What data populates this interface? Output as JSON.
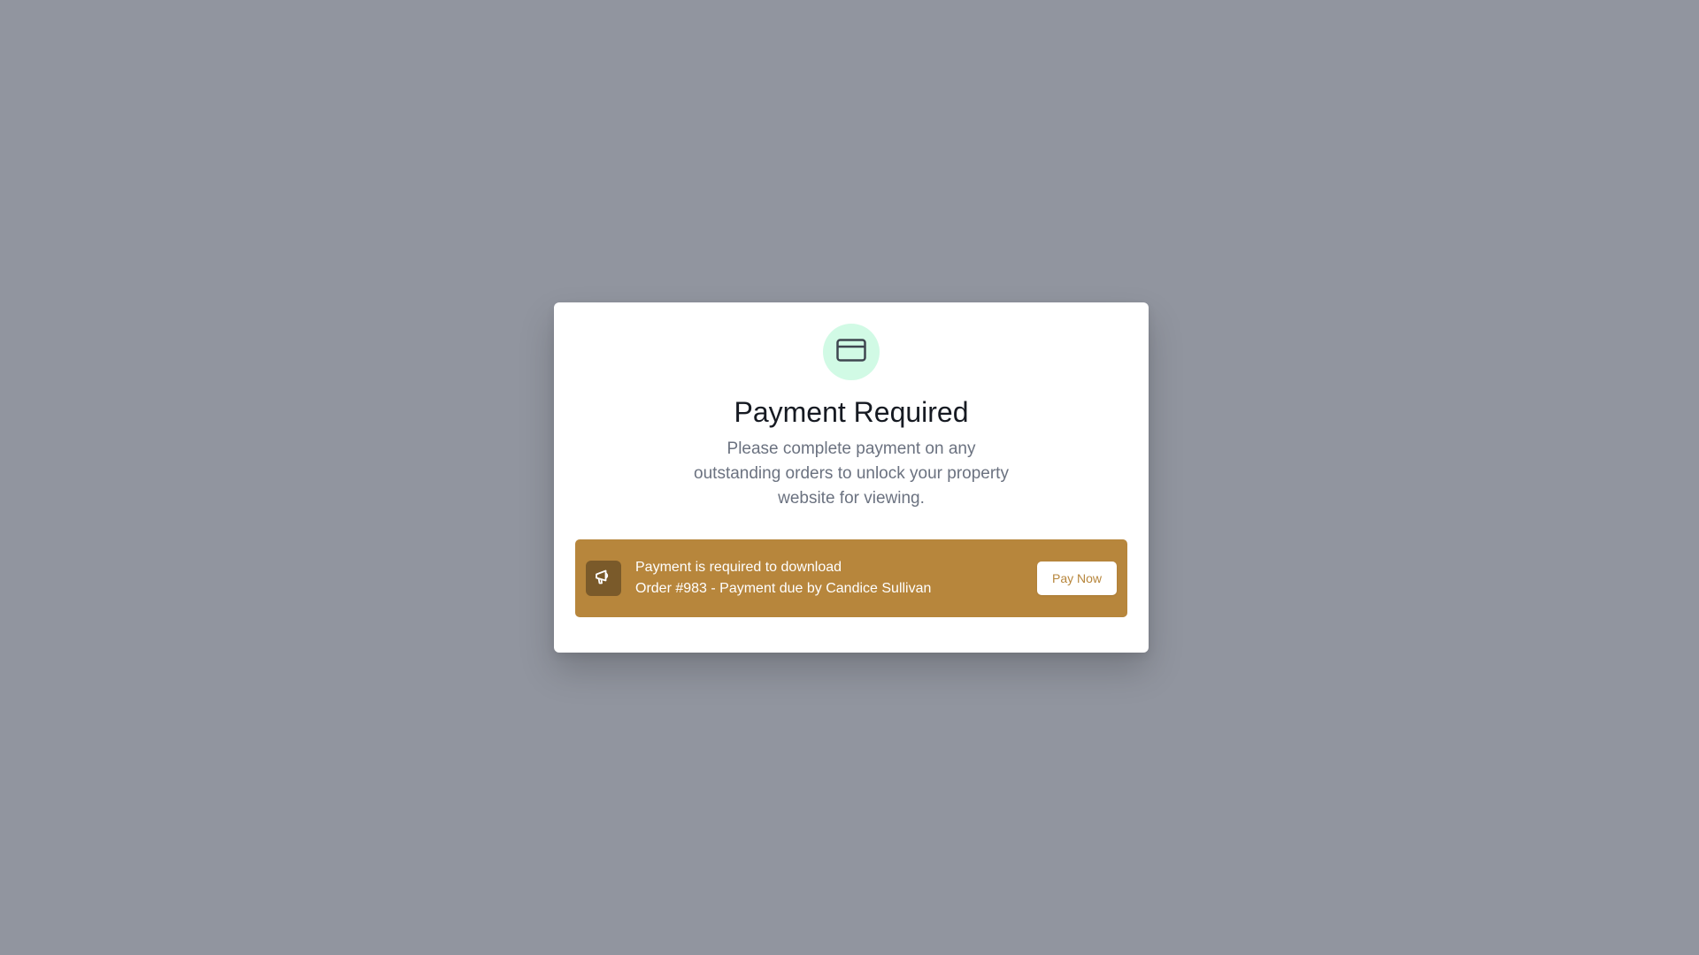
{
  "modal": {
    "icon": "credit-card-icon",
    "title": "Payment Required",
    "description": "Please complete payment on any outstanding orders to unlock your property website for viewing."
  },
  "banner": {
    "icon": "megaphone-icon",
    "heading": "Payment is required to download",
    "detail": "Order #983 - Payment due by Candice Sullivan",
    "button_label": "Pay Now"
  },
  "colors": {
    "overlay": "#91959f",
    "icon_circle": "#d1fae5",
    "banner": "#b7863c",
    "banner_icon_bg": "#7a5a2a",
    "title": "#161a22",
    "description": "#6b7280"
  }
}
